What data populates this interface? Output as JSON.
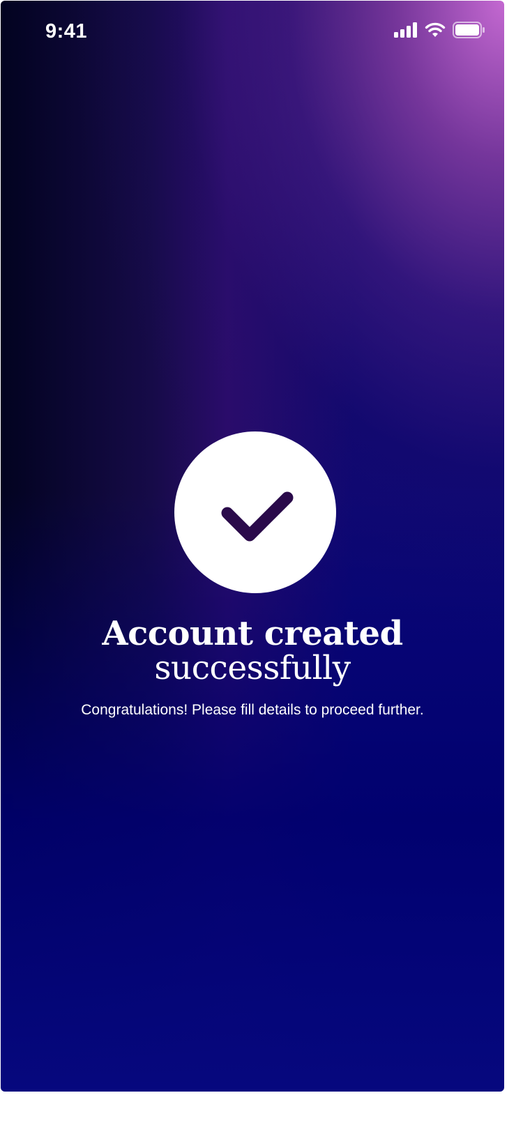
{
  "status_bar": {
    "time": "9:41",
    "icons": [
      "cellular-signal-icon",
      "wifi-icon",
      "battery-icon"
    ]
  },
  "success": {
    "icon": "checkmark-icon",
    "title_line1": "Account created",
    "title_line2": "successfully",
    "message": "Congratulations! Please fill details to proceed further."
  },
  "colors": {
    "checkmark": "#2a0a4a",
    "background_top_right": "#c06ad0",
    "background_bottom": "#06087e",
    "text": "#ffffff"
  }
}
